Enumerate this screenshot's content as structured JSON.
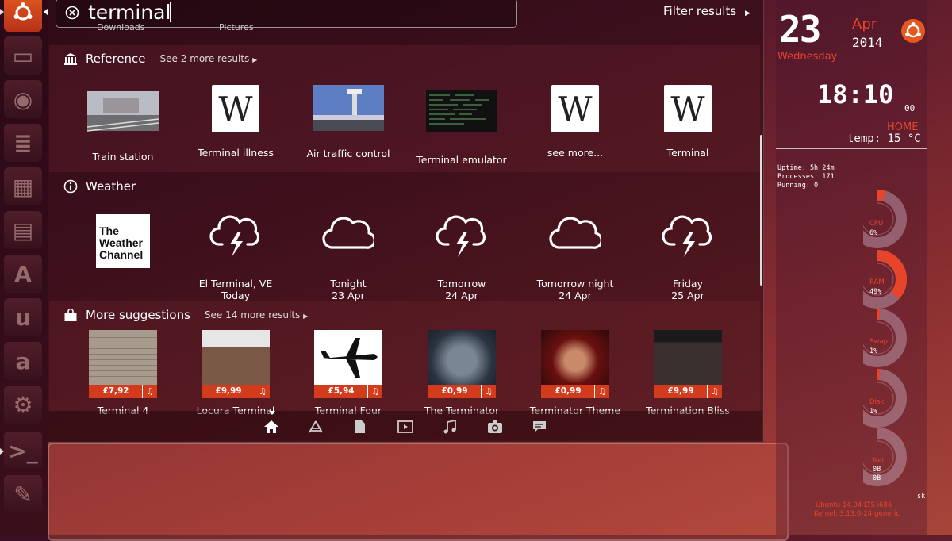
{
  "search": {
    "query": "terminal",
    "filter_label": "Filter results"
  },
  "reference": {
    "title": "Reference",
    "more": "See 2 more results",
    "items": [
      {
        "label": "Train station",
        "icon": "photo"
      },
      {
        "label": "Terminal illness",
        "icon": "wikipedia-w"
      },
      {
        "label": "Air traffic control",
        "icon": "photo"
      },
      {
        "label": "Terminal emulator",
        "icon": "photo"
      },
      {
        "label": "see more...",
        "icon": "wikipedia-w"
      },
      {
        "label": "Terminal",
        "icon": "wikipedia-w"
      }
    ],
    "wiki_letter": "W"
  },
  "weather": {
    "title": "Weather",
    "logo_text": [
      "The",
      "Weather",
      "Channel"
    ],
    "items": [
      {
        "label": "El Terminal, VE",
        "sub": "Today",
        "icon": "storm-cloud-icon"
      },
      {
        "label": "Tonight",
        "sub": "23 Apr",
        "icon": "cloud-icon"
      },
      {
        "label": "Tomorrow",
        "sub": "24 Apr",
        "icon": "storm-cloud-icon"
      },
      {
        "label": "Tomorrow night",
        "sub": "24 Apr",
        "icon": "cloud-icon"
      },
      {
        "label": "Friday",
        "sub": "25 Apr",
        "icon": "storm-cloud-icon"
      }
    ]
  },
  "suggestions": {
    "title": "More suggestions",
    "more": "See 14 more results",
    "items": [
      {
        "label": "Terminal 4",
        "price": "£7,92"
      },
      {
        "label": "Locura Terminal",
        "price": "£9,99"
      },
      {
        "label": "Terminal Four",
        "price": "£5,94"
      },
      {
        "label": "The Terminator",
        "price": "£0,99"
      },
      {
        "label": "Terminator Theme",
        "price": "£0,99"
      },
      {
        "label": "Termination Bliss",
        "price": "£9,99"
      }
    ],
    "partial_row": {
      "left": "Downloads",
      "mid": "Pictures"
    }
  },
  "lenses": [
    "home-icon",
    "applications-icon",
    "files-icon",
    "video-icon",
    "music-icon",
    "photos-icon",
    "social-icon"
  ],
  "conky": {
    "day": "23",
    "month": "Apr",
    "year": "2014",
    "weekday": "Wednesday",
    "time": "18:10",
    "seconds": "00",
    "home": "HOME",
    "temp": "temp: 15 °C",
    "uptime": "Uptime: 5h 24m",
    "processes": "Processes: 171",
    "running": "Running: 0",
    "gauges": [
      {
        "name": "CPU",
        "value": "6%",
        "fraction": 0.06
      },
      {
        "name": "RAM",
        "value": "49%",
        "fraction": 0.49
      },
      {
        "name": "Swap",
        "value": "1%",
        "fraction": 0.01
      },
      {
        "name": "Disk",
        "value": "1%",
        "fraction": 0.01
      },
      {
        "name": "Net",
        "value": "0B",
        "value2": "0B",
        "fraction": 0.0
      }
    ],
    "os": "Ubuntu 14.04 LTS  i686",
    "kernel": "Kernel: 3.13.0-24-generic",
    "user_fragment": "sk"
  },
  "colors": {
    "accent": "#e8442a",
    "ubuntu_orange": "#e4581f",
    "price_tag": "#d23b1c"
  }
}
